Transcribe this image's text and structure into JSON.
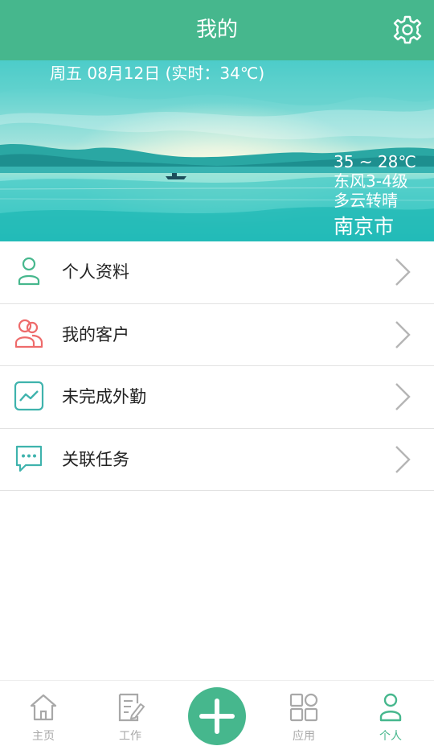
{
  "header": {
    "title": "我的",
    "settings_icon": "gear-icon"
  },
  "weather": {
    "date_line": "周五 08月12日 (实时：34℃)",
    "temperature_range": "35 ~ 28℃",
    "wind": "东风3-4级",
    "condition": "多云转晴",
    "city": "南京市"
  },
  "menu": {
    "items": [
      {
        "label": "个人资料",
        "icon": "user-profile-icon",
        "color": "#46b78d"
      },
      {
        "label": "我的客户",
        "icon": "customers-icon",
        "color": "#ee6b6b"
      },
      {
        "label": "未完成外勤",
        "icon": "trend-chart-icon",
        "color": "#3fb3ad"
      },
      {
        "label": "关联任务",
        "icon": "chat-bubble-icon",
        "color": "#3fb3ad"
      }
    ]
  },
  "tabbar": {
    "items": [
      {
        "label": "主页",
        "icon": "home-icon",
        "active": false
      },
      {
        "label": "工作",
        "icon": "edit-note-icon",
        "active": false
      },
      {
        "label": "应用",
        "icon": "apps-grid-icon",
        "active": false
      },
      {
        "label": "个人",
        "icon": "person-icon",
        "active": true
      }
    ],
    "add_icon": "plus-icon"
  },
  "colors": {
    "brand": "#46b78d",
    "inactive": "#a8a8a8",
    "divider": "#e2e2e2"
  }
}
